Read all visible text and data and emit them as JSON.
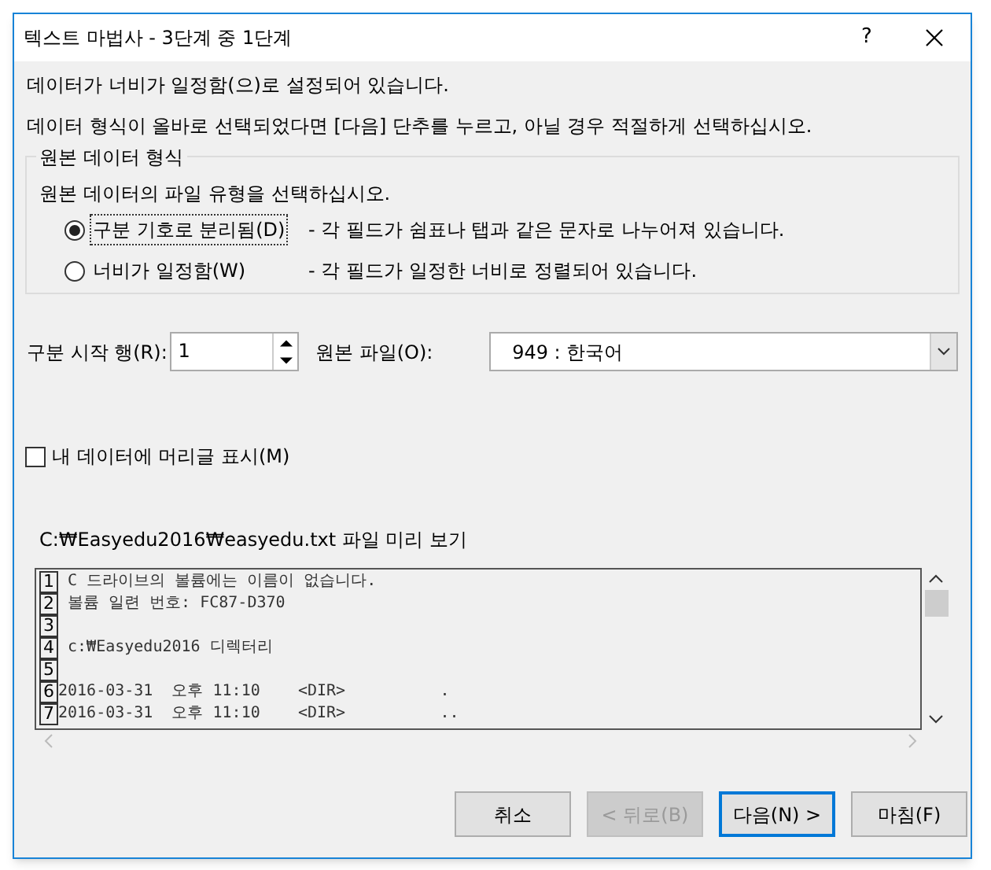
{
  "window": {
    "title": "텍스트 마법사 - 3단계 중 1단계",
    "help": "?"
  },
  "intro": [
    "데이터가 너비가 일정함(으)로 설정되어 있습니다.",
    "데이터 형식이 올바로 선택되었다면 [다음] 단추를 누르고, 아닐 경우 적절하게 선택하십시오."
  ],
  "group": {
    "title": "원본 데이터 형식",
    "prompt": "원본 데이터의 파일 유형을 선택하십시오.",
    "options": [
      {
        "label": "구분 기호로 분리됨(D)",
        "description": "- 각 필드가 쉼표나 탭과 같은 문자로 나누어져 있습니다.",
        "selected": true
      },
      {
        "label": "너비가 일정함(W)",
        "description": "- 각 필드가 일정한 너비로 정렬되어 있습니다.",
        "selected": false
      }
    ]
  },
  "start_row": {
    "label": "구분 시작 행(R):",
    "value": "1"
  },
  "file_origin": {
    "label": "원본 파일(O):",
    "value": "949 : 한국어"
  },
  "header_checkbox": {
    "label": "내 데이터에 머리글 표시(M)",
    "checked": false
  },
  "preview": {
    "title": "C:₩Easyedu2016₩easyedu.txt 파일 미리 보기",
    "lines": [
      {
        "number": "1",
        "text": " C 드라이브의 볼륨에는 이름이 없습니다."
      },
      {
        "number": "2",
        "text": " 볼륨 일련 번호: FC87-D370"
      },
      {
        "number": "3"
      },
      {
        "number": "4",
        "text": " c:₩Easyedu2016 디렉터리"
      },
      {
        "number": "5"
      },
      {
        "number": "6",
        "text": "2016-03-31  오후 11:10    <DIR>          ."
      },
      {
        "number": "7",
        "text": "2016-03-31  오후 11:10    <DIR>          .."
      }
    ]
  },
  "buttons": [
    {
      "label": "취소",
      "disabled": false,
      "default": false
    },
    {
      "label": "< 뒤로(B)",
      "disabled": true,
      "default": false
    },
    {
      "label": "다음(N) >",
      "disabled": false,
      "default": true
    },
    {
      "label": "마침(F)",
      "disabled": false,
      "default": false
    }
  ]
}
